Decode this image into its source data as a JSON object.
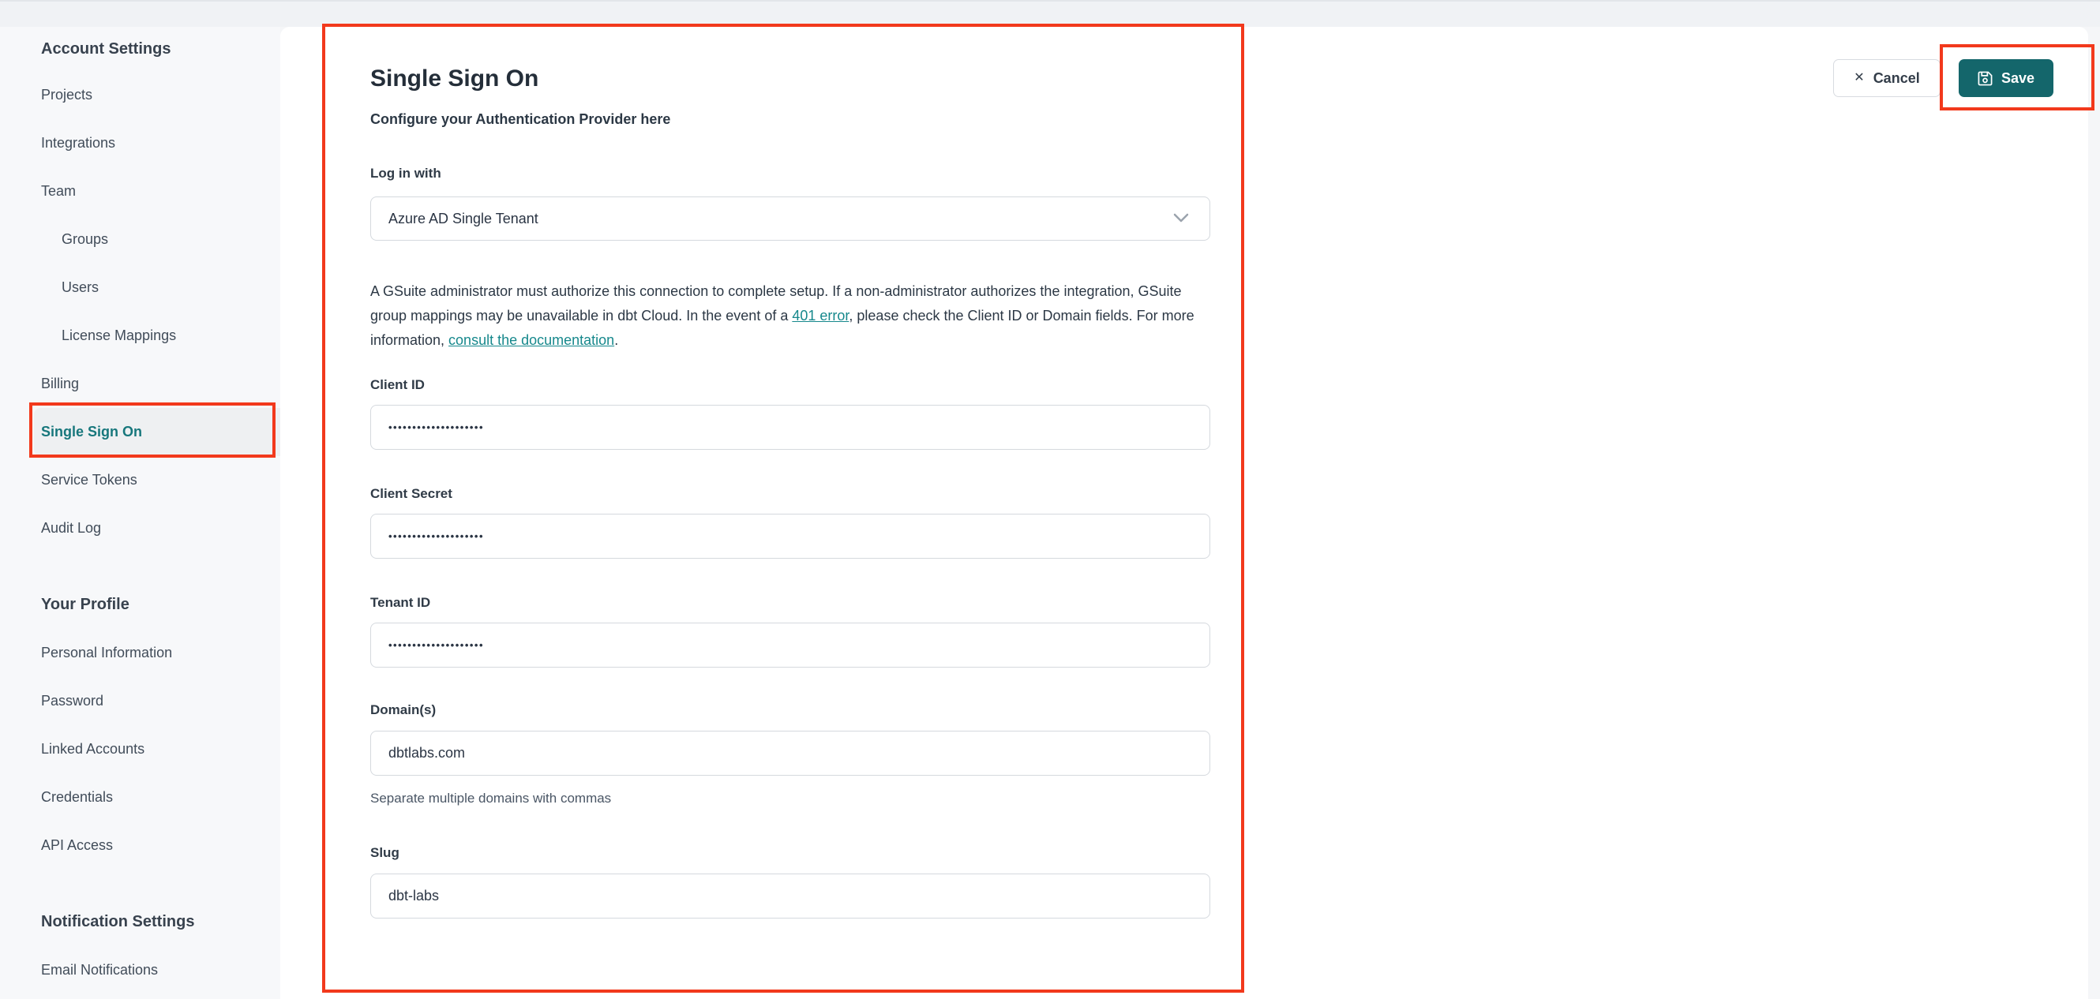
{
  "sidebar": {
    "sections": [
      {
        "heading": "Account Settings",
        "items": [
          {
            "label": "Projects"
          },
          {
            "label": "Integrations"
          },
          {
            "label": "Team"
          },
          {
            "label": "Groups"
          },
          {
            "label": "Users"
          },
          {
            "label": "License Mappings"
          },
          {
            "label": "Billing"
          },
          {
            "label": "Single Sign On"
          },
          {
            "label": "Service Tokens"
          },
          {
            "label": "Audit Log"
          }
        ]
      },
      {
        "heading": "Your Profile",
        "items": [
          {
            "label": "Personal Information"
          },
          {
            "label": "Password"
          },
          {
            "label": "Linked Accounts"
          },
          {
            "label": "Credentials"
          },
          {
            "label": "API Access"
          }
        ]
      },
      {
        "heading": "Notification Settings",
        "items": [
          {
            "label": "Email Notifications"
          }
        ]
      }
    ]
  },
  "main": {
    "title": "Single Sign On",
    "subtitle": "Configure your Authentication Provider here",
    "login_with": {
      "label": "Log in with",
      "value": "Azure AD Single Tenant"
    },
    "notice": {
      "part1": "A GSuite administrator must authorize this connection to complete setup. If a non-administrator authorizes the integration, GSuite group mappings may be unavailable in dbt Cloud. In the event of a ",
      "link1": "401 error",
      "part2": ", please check the Client ID or Domain fields. For more information, ",
      "link2": "consult the documentation",
      "part3": "."
    },
    "fields": {
      "client_id": {
        "label": "Client ID",
        "value": "••••••••••••••••••••"
      },
      "client_secret": {
        "label": "Client Secret",
        "value": "••••••••••••••••••••"
      },
      "tenant_id": {
        "label": "Tenant ID",
        "value": "••••••••••••••••••••"
      },
      "domains": {
        "label": "Domain(s)",
        "value": "dbtlabs.com",
        "help": "Separate multiple domains with commas"
      },
      "slug": {
        "label": "Slug",
        "value": "dbt-labs"
      }
    },
    "actions": {
      "cancel": "Cancel",
      "save": "Save"
    }
  },
  "colors": {
    "accent_teal_button": "#14666b",
    "active_item_teal": "#17777c",
    "link_teal": "#16888c",
    "annotation_red": "#f2391c"
  }
}
